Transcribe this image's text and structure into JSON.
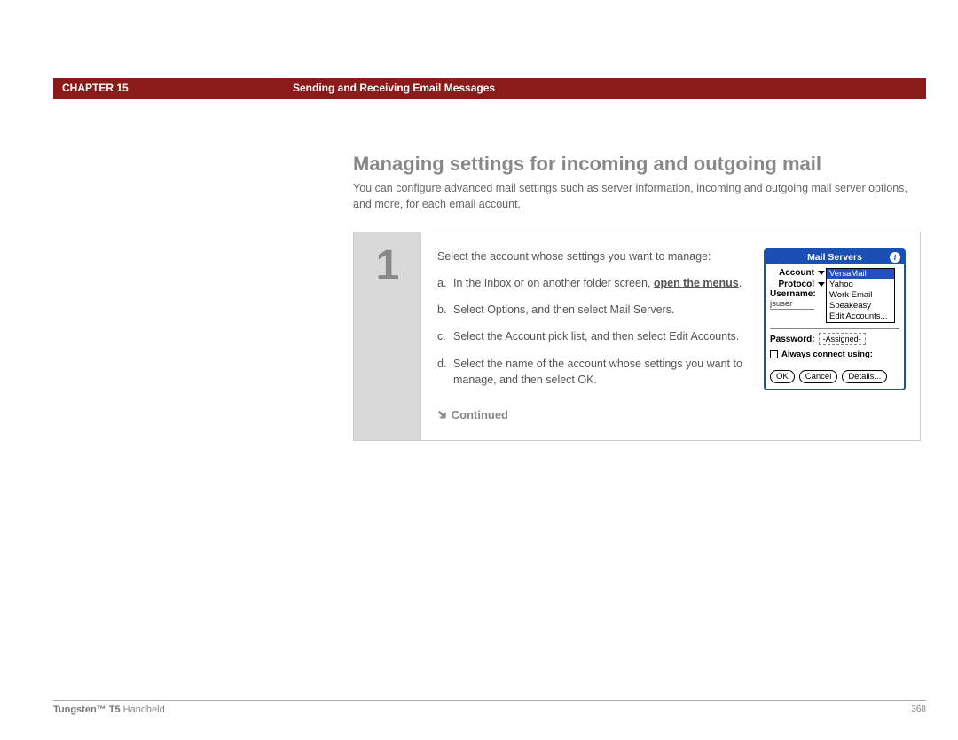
{
  "header": {
    "chapter_label": "CHAPTER 15",
    "chapter_title": "Sending and Receiving Email Messages"
  },
  "section": {
    "title": "Managing settings for incoming and outgoing mail",
    "intro": "You can configure advanced mail settings such as server information, incoming and outgoing mail server options, and more, for each email account."
  },
  "step": {
    "number": "1",
    "intro": "Select the account whose settings you want to manage:",
    "a_pre": "In the Inbox or on another folder screen, ",
    "a_bold": "open the menus",
    "a_post": ".",
    "b": "Select Options, and then select Mail Servers.",
    "c": "Select the Account pick list, and then select Edit Accounts.",
    "d": "Select the name of the account whose settings you want to manage, and then select OK.",
    "continued": "Continued"
  },
  "palm": {
    "title": "Mail Servers",
    "info_icon": "i",
    "account_label": "Account",
    "protocol_label": "Protocol",
    "username_label": "Username:",
    "username_value": "jsuser",
    "dropdown": {
      "selected": "VersaMail",
      "opt2": "Yahoo",
      "opt3": "Work Email",
      "opt4": "Speakeasy",
      "opt5": "Edit Accounts..."
    },
    "password_label": "Password:",
    "password_value": "-Assigned-",
    "checkbox_label": "Always connect using:",
    "btn_ok": "OK",
    "btn_cancel": "Cancel",
    "btn_details": "Details..."
  },
  "footer": {
    "product_bold": "Tungsten™ T5",
    "product_rest": " Handheld",
    "page": "368"
  }
}
